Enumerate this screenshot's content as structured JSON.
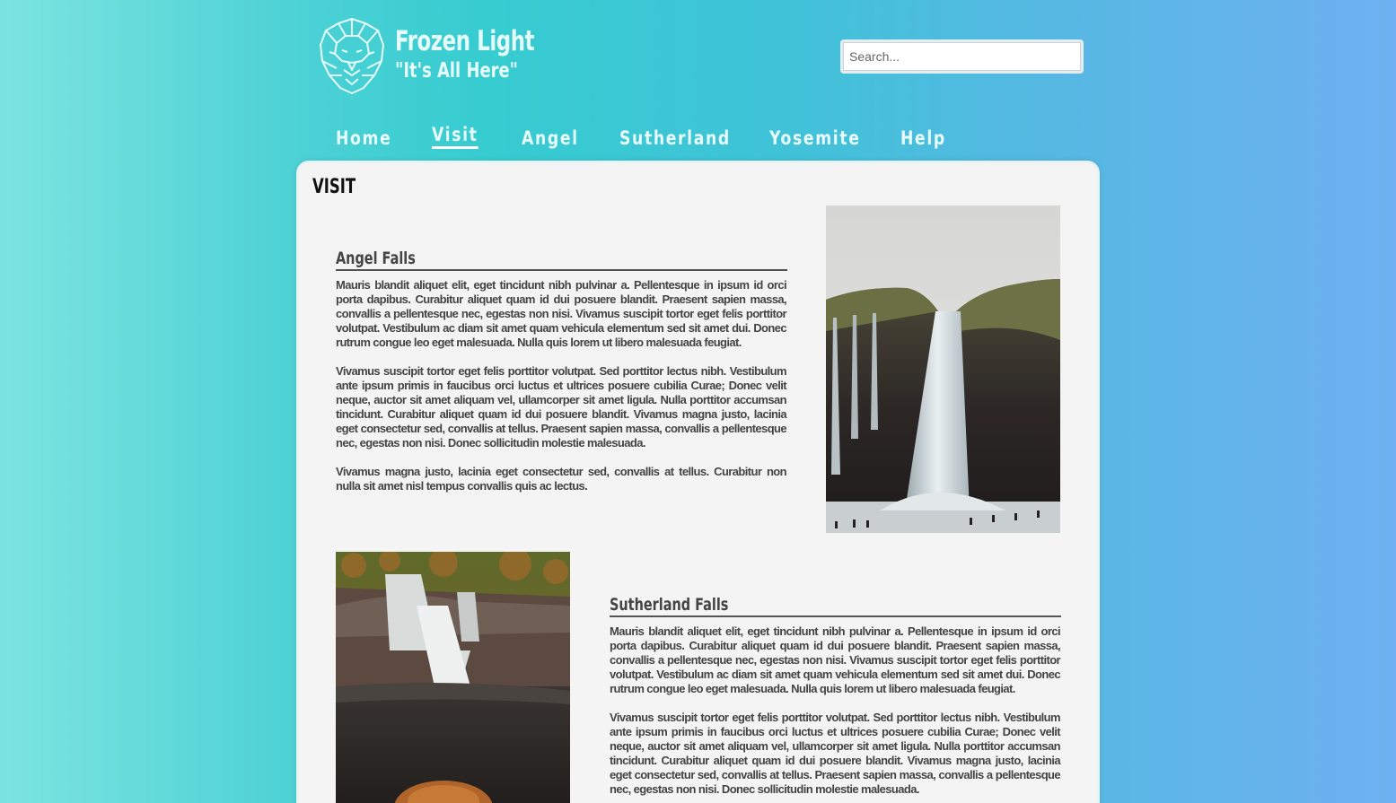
{
  "brand": {
    "title": "Frozen Light",
    "tagline": "\"It's All Here\""
  },
  "search": {
    "placeholder": "Search...",
    "value": ""
  },
  "nav": {
    "items": [
      {
        "label": "Home"
      },
      {
        "label": "Visit"
      },
      {
        "label": "Angel"
      },
      {
        "label": "Sutherland"
      },
      {
        "label": "Yosemite"
      },
      {
        "label": "Help"
      }
    ],
    "active": "Visit"
  },
  "page": {
    "title": "VISIT"
  },
  "sections": [
    {
      "heading": "Angel Falls",
      "paragraphs": [
        "Mauris blandit aliquet elit, eget tincidunt nibh pulvinar a. Pellentesque in ipsum id orci porta dapibus. Curabitur aliquet quam id dui posuere blandit. Praesent sapien massa, convallis a pellentesque nec, egestas non nisi. Vivamus suscipit tortor eget felis porttitor volutpat. Vestibulum ac diam sit amet quam vehicula elementum sed sit amet dui. Donec rutrum congue leo eget malesuada. Nulla quis lorem ut libero malesuada feugiat.",
        "Vivamus suscipit tortor eget felis porttitor volutpat. Sed porttitor lectus nibh. Vestibulum ante ipsum primis in faucibus orci luctus et ultrices posuere cubilia Curae; Donec velit neque, auctor sit amet aliquam vel, ullamcorper sit amet ligula. Nulla porttitor accumsan tincidunt. Curabitur aliquet quam id dui posuere blandit. Vivamus magna justo, lacinia eget consectetur sed, convallis at tellus. Praesent sapien massa, convallis a pellentesque nec, egestas non nisi. Donec sollicitudin molestie malesuada.",
        "Vivamus magna justo, lacinia eget consectetur sed, convallis at tellus. Curabitur non nulla sit amet nisl tempus convallis quis ac lectus."
      ]
    },
    {
      "heading": "Sutherland Falls",
      "paragraphs": [
        "Mauris blandit aliquet elit, eget tincidunt nibh pulvinar a. Pellentesque in ipsum id orci porta dapibus. Curabitur aliquet quam id dui posuere blandit. Praesent sapien massa, convallis a pellentesque nec, egestas non nisi. Vivamus suscipit tortor eget felis porttitor volutpat. Vestibulum ac diam sit amet quam vehicula elementum sed sit amet dui. Donec rutrum congue leo eget malesuada. Nulla quis lorem ut libero malesuada feugiat.",
        "Vivamus suscipit tortor eget felis porttitor volutpat. Sed porttitor lectus nibh. Vestibulum ante ipsum primis in faucibus orci luctus et ultrices posuere cubilia Curae; Donec velit neque, auctor sit amet aliquam vel, ullamcorper sit amet ligula. Nulla porttitor accumsan tincidunt. Curabitur aliquet quam id dui posuere blandit. Vivamus magna justo, lacinia eget consectetur sed, convallis at tellus. Praesent sapien massa, convallis a pellentesque nec, egestas non nisi. Donec sollicitudin molestie malesuada."
      ]
    }
  ],
  "colors": {
    "text_on_brand": "#e6fbfb",
    "panel": "#f4f4f4",
    "body_text": "#444444"
  },
  "icons": {
    "logo": "lion-head-icon"
  }
}
